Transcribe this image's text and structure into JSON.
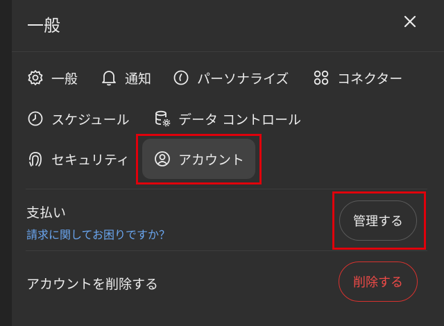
{
  "header": {
    "title": "一般"
  },
  "nav": {
    "general": "一般",
    "notifications": "通知",
    "personalize": "パーソナライズ",
    "connectors": "コネクター",
    "schedule": "スケジュール",
    "data_controls": "データ コントロール",
    "security": "セキュリティ",
    "account": "アカウント",
    "active": "account"
  },
  "billing": {
    "title": "支払い",
    "help_link": "請求に関してお困りですか？",
    "manage_label": "管理する"
  },
  "delete_account": {
    "label": "アカウントを削除する",
    "button_label": "削除する"
  },
  "colors": {
    "panel": "#2f2f2f",
    "highlight": "#e0000b",
    "link": "#6aa6f0",
    "danger": "#ef4a47"
  }
}
